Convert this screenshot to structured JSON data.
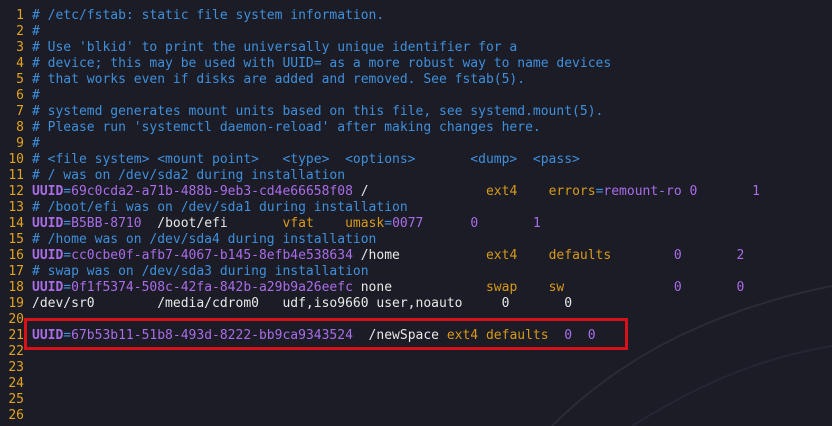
{
  "lines": [
    {
      "n": "1",
      "comment": "# /etc/fstab: static file system information."
    },
    {
      "n": "2",
      "comment": "#"
    },
    {
      "n": "3",
      "comment": "# Use 'blkid' to print the universally unique identifier for a"
    },
    {
      "n": "4",
      "comment": "# device; this may be used with UUID= as a more robust way to name devices"
    },
    {
      "n": "5",
      "comment": "# that works even if disks are added and removed. See fstab(5)."
    },
    {
      "n": "6",
      "comment": "#"
    },
    {
      "n": "7",
      "comment": "# systemd generates mount units based on this file, see systemd.mount(5)."
    },
    {
      "n": "8",
      "comment": "# Please run 'systemctl daemon-reload' after making changes here."
    },
    {
      "n": "9",
      "comment": "#"
    },
    {
      "n": "10",
      "comment": "# <file system> <mount point>   <type>  <options>       <dump>  <pass>"
    },
    {
      "n": "11",
      "comment": "# / was on /dev/sda2 during installation"
    },
    {
      "n": "12",
      "key": "UUID",
      "eq": "=",
      "uuid": "69c0cda2-a71b-488b-9eb3-cd4e66658f08",
      "mount": " /               ",
      "type": "ext4",
      "sep": "    ",
      "opt": "errors",
      "opteq": "=",
      "optval": "remount-ro",
      "dump": " 0",
      "pass": "       1"
    },
    {
      "n": "13",
      "comment": "# /boot/efi was on /dev/sda1 during installation"
    },
    {
      "n": "14",
      "key": "UUID",
      "eq": "=",
      "uuid": "B5BB-8710",
      "mount": "  /boot/efi       ",
      "type": "vfat",
      "sep": "    ",
      "opt": "umask",
      "opteq": "=",
      "optval": "0077",
      "dump": "      0",
      "pass": "       1"
    },
    {
      "n": "15",
      "comment": "# /home was on /dev/sda4 during installation"
    },
    {
      "n": "16",
      "key": "UUID",
      "eq": "=",
      "uuid": "cc0cbe0f-afb7-4067-b145-8efb4e538634",
      "mount": " /home           ",
      "type": "ext4",
      "sep": "    ",
      "opt": "defaults",
      "opteq": "",
      "optval": "",
      "dump": "        0",
      "pass": "       2"
    },
    {
      "n": "17",
      "comment": "# swap was on /dev/sda3 during installation"
    },
    {
      "n": "18",
      "key": "UUID",
      "eq": "=",
      "uuid": "0f1f5374-508c-42fa-842b-a29b9a26eefc",
      "mount": " none            ",
      "type": "swap",
      "sep": "    ",
      "opt": "sw",
      "opteq": "",
      "optval": "",
      "dump": "              0",
      "pass": "       0"
    },
    {
      "n": "19",
      "plain": "/dev/sr0        /media/cdrom0   udf,iso9660 user,noauto     0       0"
    },
    {
      "n": "20",
      "plain": ""
    },
    {
      "n": "21",
      "key": "UUID",
      "eq": "=",
      "uuid": "67b53b11-51b8-493d-8222-bb9ca9343524",
      "mount": "  /newSpace ",
      "type": "ext4",
      "sep": " ",
      "opt": "defaults",
      "opteq": "",
      "optval": "",
      "dump": "  0",
      "pass": "  0"
    },
    {
      "n": "22",
      "plain": ""
    },
    {
      "n": "23",
      "plain": ""
    },
    {
      "n": "24",
      "plain": ""
    },
    {
      "n": "25",
      "plain": ""
    },
    {
      "n": "26",
      "plain": ""
    }
  ],
  "colors": {
    "background": "#1b1c26",
    "line_number": "#e3a31b",
    "comment": "#3f8fdb",
    "uuid": "#a96de8",
    "type": "#d89a1a",
    "highlight_border": "#d8101a"
  }
}
